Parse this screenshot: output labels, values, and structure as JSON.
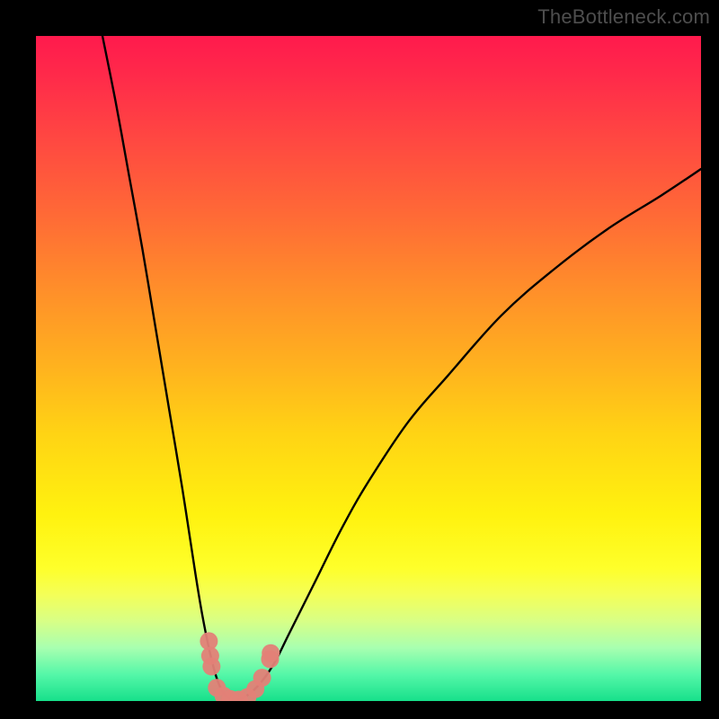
{
  "watermark": "TheBottleneck.com",
  "colors": {
    "background": "#000000",
    "curve": "#000000",
    "marker": "#e38177",
    "gradient_top": "#ff1a4d",
    "gradient_bottom": "#17e08b"
  },
  "chart_data": {
    "type": "line",
    "title": "",
    "xlabel": "",
    "ylabel": "",
    "xlim": [
      0,
      100
    ],
    "ylim": [
      0,
      100
    ],
    "grid": false,
    "legend": false,
    "series": [
      {
        "name": "left-branch",
        "x": [
          10,
          12,
          14,
          16,
          18,
          20,
          22,
          24,
          25,
          26,
          27,
          28,
          29,
          30
        ],
        "y": [
          100,
          90,
          79,
          68,
          56,
          44,
          32,
          19,
          13,
          8,
          4,
          1.5,
          0.5,
          0
        ]
      },
      {
        "name": "right-branch",
        "x": [
          30,
          32,
          34,
          36,
          38,
          42,
          46,
          50,
          56,
          62,
          70,
          78,
          86,
          94,
          100
        ],
        "y": [
          0,
          1,
          3,
          6,
          10,
          18,
          26,
          33,
          42,
          49,
          58,
          65,
          71,
          76,
          80
        ]
      }
    ],
    "markers": {
      "name": "highlighted-cluster",
      "points": [
        {
          "x": 26.0,
          "y": 9.0
        },
        {
          "x": 26.2,
          "y": 6.8
        },
        {
          "x": 26.4,
          "y": 5.2
        },
        {
          "x": 27.2,
          "y": 2.0
        },
        {
          "x": 28.2,
          "y": 0.8
        },
        {
          "x": 29.2,
          "y": 0.3
        },
        {
          "x": 30.5,
          "y": 0.2
        },
        {
          "x": 31.8,
          "y": 0.6
        },
        {
          "x": 33.0,
          "y": 1.8
        },
        {
          "x": 34.0,
          "y": 3.5
        },
        {
          "x": 35.2,
          "y": 6.3
        },
        {
          "x": 35.3,
          "y": 7.2
        }
      ]
    }
  }
}
